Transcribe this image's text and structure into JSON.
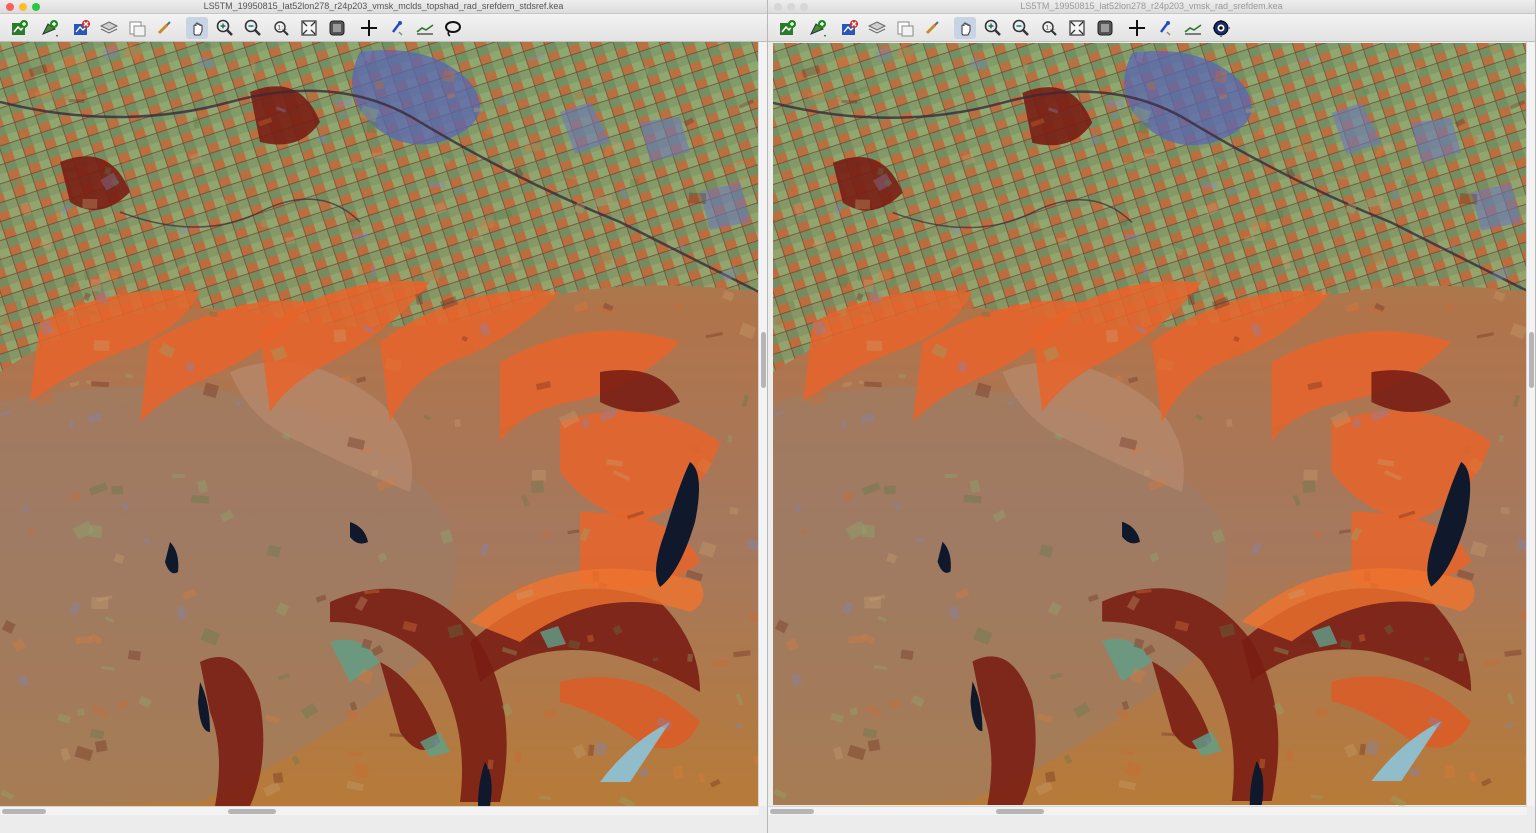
{
  "windows": [
    {
      "title": "LS5TM_19950815_lat52lon278_r24p203_vmsk_mclds_topshad_rad_srefdem_stdsref.kea",
      "last_tool_icon": "lasso-select-icon"
    },
    {
      "title": "LS5TM_19950815_lat52lon278_r24p203_vmsk_rad_srefdem.kea",
      "last_tool_icon": "eye-icon"
    }
  ],
  "toolbar_tools": [
    "add-layer-icon",
    "add-vector-layer-icon",
    "remove-layer-icon",
    "layers-icon",
    "new-window-icon",
    "arrange-icon",
    "pan-icon",
    "zoom-in-icon",
    "zoom-out-icon",
    "zoom-native-icon",
    "zoom-full-extent-icon",
    "follow-extent-icon",
    "cursor-query-icon",
    "query-point-icon",
    "profile-icon"
  ],
  "image_description_colors": {
    "accent_orange": "#e8642a",
    "deep_red": "#7a1e14",
    "veg_green": "#7fa46a",
    "urban_blue": "#5966b3",
    "water": "#10182c",
    "upland_tan": "#a9775c"
  }
}
